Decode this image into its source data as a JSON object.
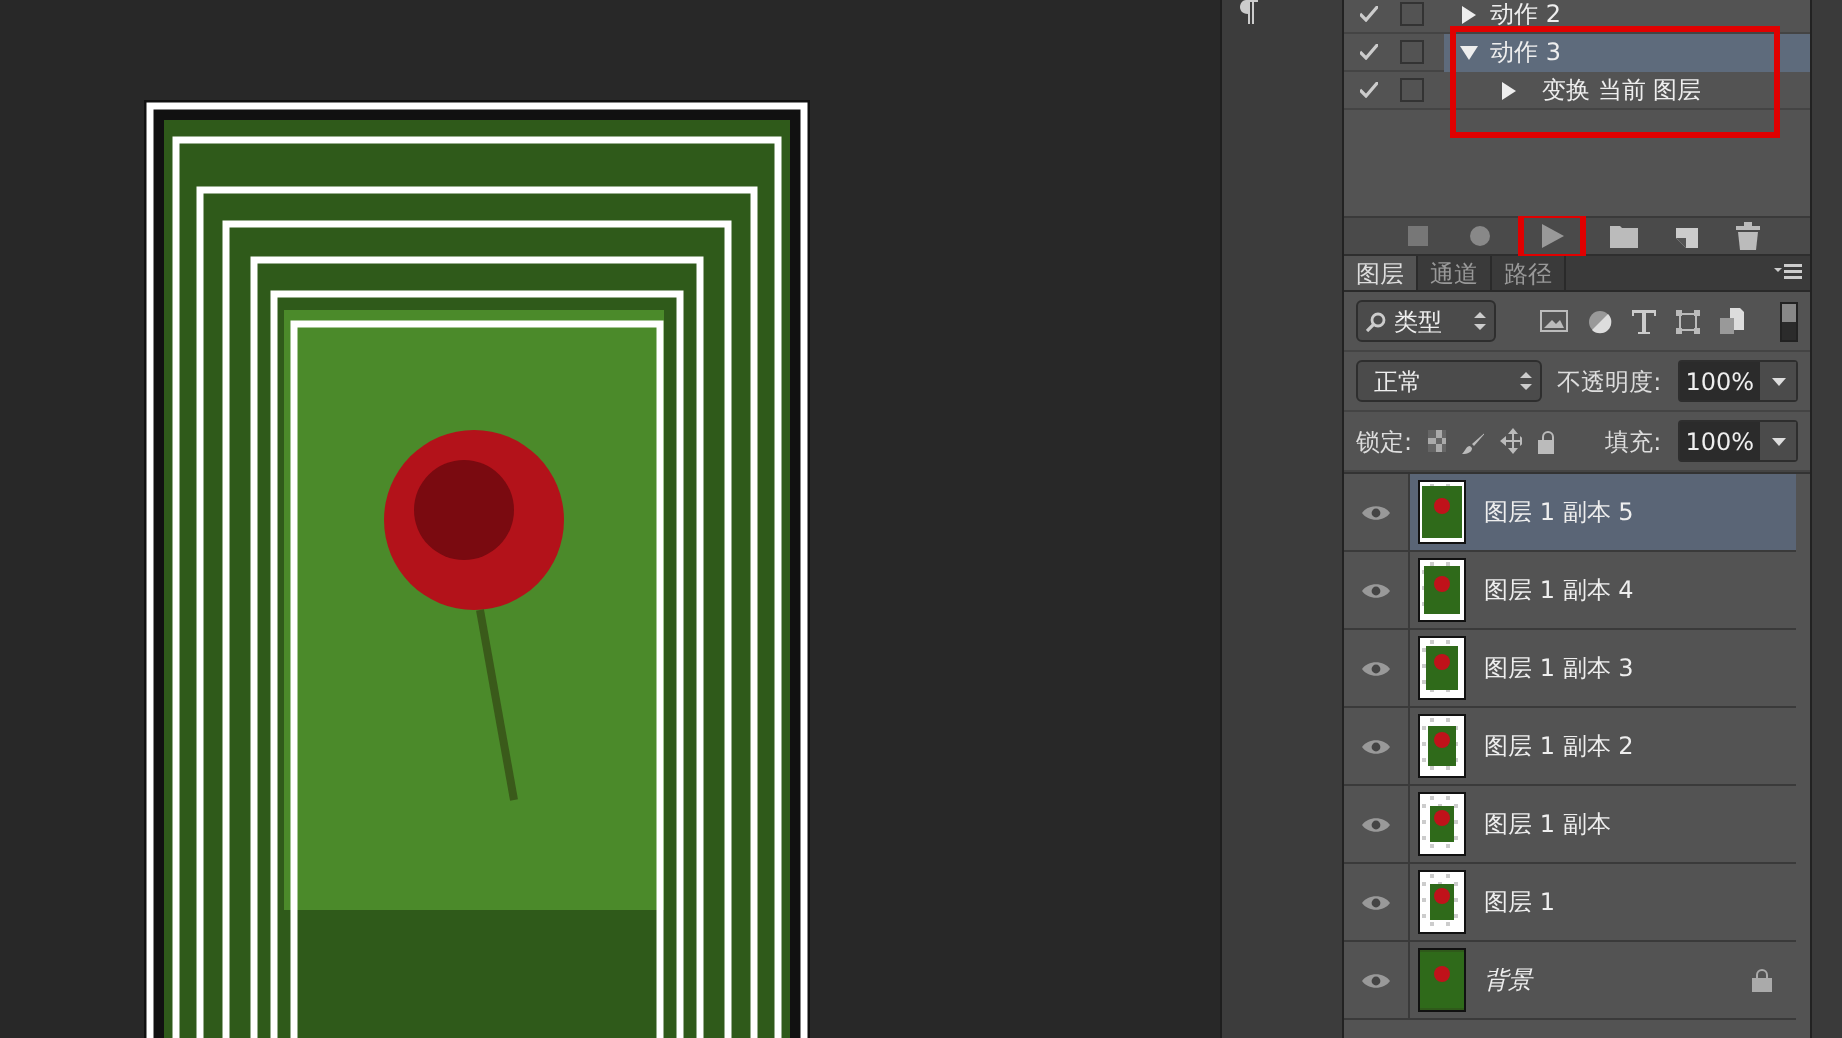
{
  "actions": [
    {
      "label": "动作 2",
      "checked": true,
      "expanded": false,
      "selected": false,
      "highlighted": false
    },
    {
      "label": "动作 3",
      "checked": true,
      "expanded": true,
      "selected": true,
      "highlighted": true,
      "children": [
        {
          "label": "变换 当前 图层",
          "checked": true,
          "expanded": false,
          "selected": false
        }
      ]
    }
  ],
  "action_buttons": [
    {
      "kind": "stop",
      "highlighted": false
    },
    {
      "kind": "record",
      "highlighted": false
    },
    {
      "kind": "play",
      "highlighted": true
    },
    {
      "kind": "folder",
      "highlighted": false
    },
    {
      "kind": "new",
      "highlighted": false
    },
    {
      "kind": "trash",
      "highlighted": false
    }
  ],
  "layer_tabs": [
    {
      "label": "图层",
      "selected": true
    },
    {
      "label": "通道",
      "selected": false
    },
    {
      "label": "路径",
      "selected": false
    }
  ],
  "filter": {
    "value": "类型"
  },
  "blend_mode": {
    "value": "正常"
  },
  "opacity": {
    "label": "不透明度:",
    "value": "100%"
  },
  "lock": {
    "label": "锁定:"
  },
  "fill": {
    "label": "填充:",
    "value": "100%"
  },
  "layers": [
    {
      "name": "图层 1 副本 5",
      "kind": "layer",
      "selected": true,
      "visible": true,
      "locked": false
    },
    {
      "name": "图层 1 副本 4",
      "kind": "layer",
      "selected": false,
      "visible": true,
      "locked": false
    },
    {
      "name": "图层 1 副本 3",
      "kind": "layer",
      "selected": false,
      "visible": true,
      "locked": false
    },
    {
      "name": "图层 1 副本 2",
      "kind": "layer",
      "selected": false,
      "visible": true,
      "locked": false
    },
    {
      "name": "图层 1 副本",
      "kind": "layer",
      "selected": false,
      "visible": true,
      "locked": false
    },
    {
      "name": "图层 1",
      "kind": "layer",
      "selected": false,
      "visible": true,
      "locked": false
    },
    {
      "name": "背景",
      "kind": "background",
      "selected": false,
      "visible": true,
      "locked": true
    }
  ]
}
